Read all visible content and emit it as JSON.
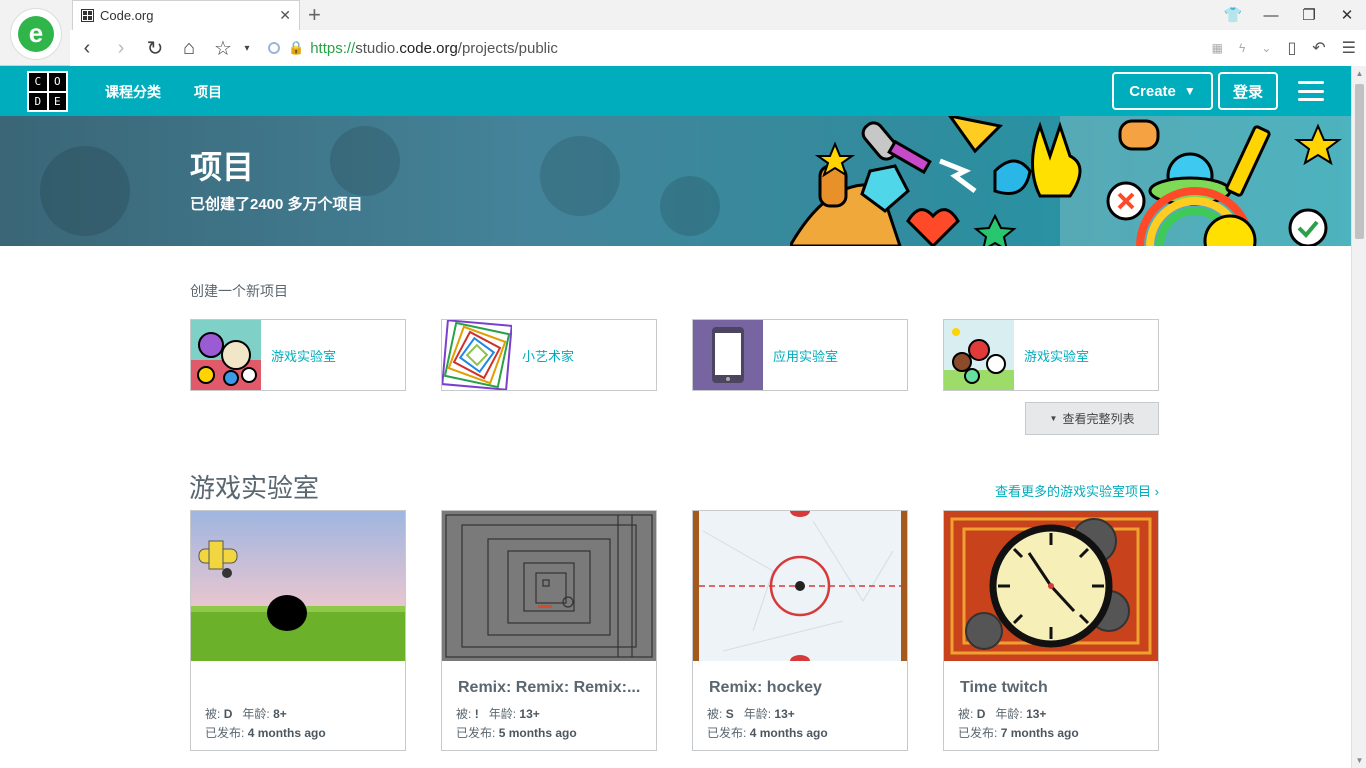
{
  "browser": {
    "tab_title": "Code.org",
    "tab_close": "✕",
    "new_tab": "+",
    "url_scheme": "https://",
    "url_domain_pre": "studio.",
    "url_domain": "code.org",
    "url_path": "/projects/public",
    "icons": [
      "back-icon",
      "forward-icon",
      "reload-icon",
      "home-icon",
      "star-icon",
      "shield-icon",
      "lock-icon",
      "qr-icon",
      "flash-icon",
      "reader-icon",
      "undo-icon",
      "menu-icon"
    ]
  },
  "header": {
    "logo_letters": [
      "C",
      "O",
      "D",
      "E"
    ],
    "nav": [
      "课程分类",
      "项目"
    ],
    "create_label": "Create",
    "login_label": "登录"
  },
  "banner": {
    "title": "项目",
    "subtitle": "已创建了2400 多万个项目"
  },
  "new_project": {
    "label": "创建一个新项目",
    "items": [
      {
        "label": "游戏实验室"
      },
      {
        "label": "小艺术家"
      },
      {
        "label": "应用实验室"
      },
      {
        "label": "游戏实验室"
      }
    ],
    "view_all": "查看完整列表"
  },
  "gallery": {
    "title": "游戏实验室",
    "more_link": "查看更多的游戏实验室项目 ›",
    "by_label": "被:",
    "age_label": "年龄:",
    "published_label": "已发布:",
    "projects": [
      {
        "title": "",
        "author": "D",
        "age": "8+",
        "published": "4 months ago"
      },
      {
        "title": "Remix: Remix: Remix:...",
        "author": "!",
        "age": "13+",
        "published": "5 months ago"
      },
      {
        "title": "Remix: hockey",
        "author": "S",
        "age": "13+",
        "published": "4 months ago"
      },
      {
        "title": "Time twitch",
        "author": "D",
        "age": "13+",
        "published": "7 months ago"
      }
    ]
  },
  "colors": {
    "brand_teal": "#00adbc",
    "text_gray": "#5b6770"
  }
}
